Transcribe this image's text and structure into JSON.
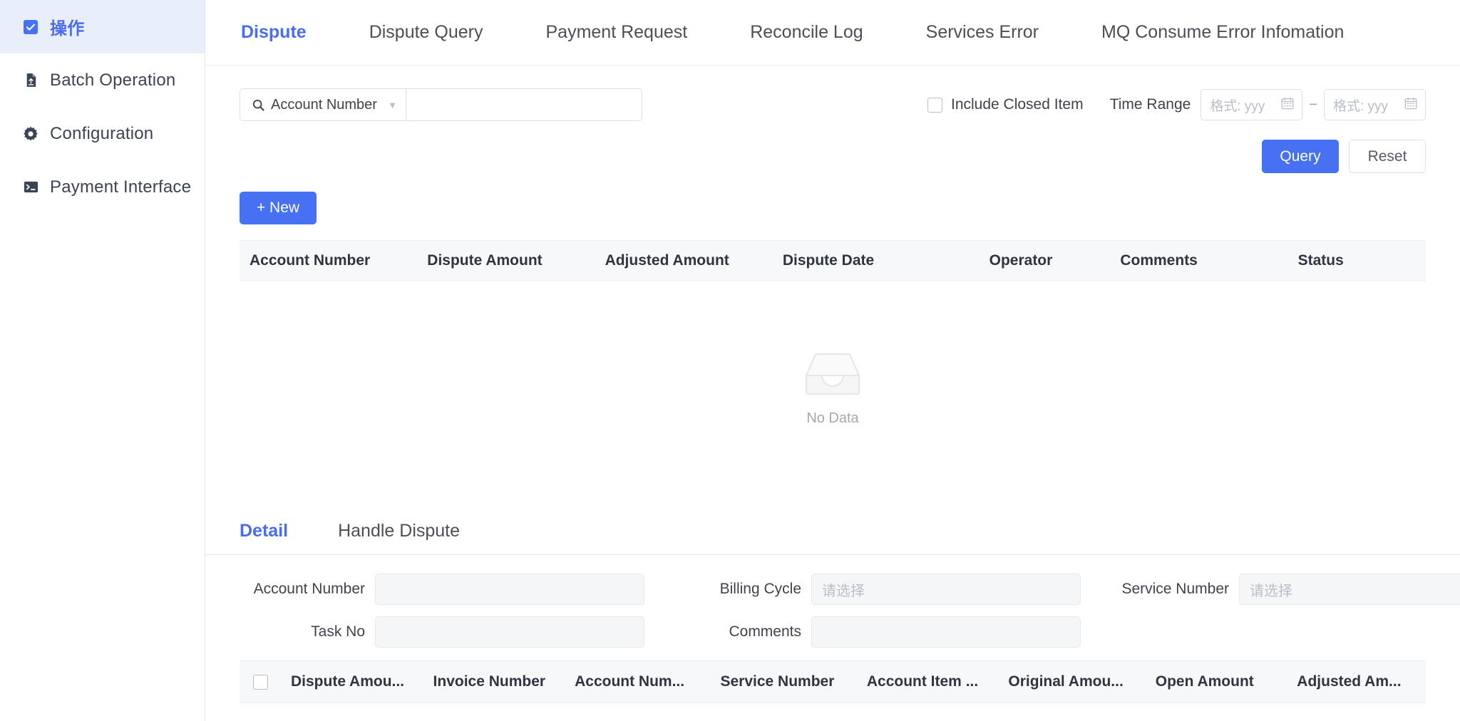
{
  "sidebar": {
    "items": [
      {
        "label": "操作",
        "icon": "checkbox-square-icon",
        "active": true
      },
      {
        "label": "Batch Operation",
        "icon": "file-upload-icon",
        "active": false
      },
      {
        "label": "Configuration",
        "icon": "gear-icon",
        "active": false
      },
      {
        "label": "Payment Interface",
        "icon": "terminal-icon",
        "active": false
      }
    ]
  },
  "tabs": [
    {
      "label": "Dispute",
      "active": true
    },
    {
      "label": "Dispute Query",
      "active": false
    },
    {
      "label": "Payment Request",
      "active": false
    },
    {
      "label": "Reconcile Log",
      "active": false
    },
    {
      "label": "Services Error",
      "active": false
    },
    {
      "label": "MQ Consume Error Infomation",
      "active": false
    }
  ],
  "filters": {
    "search_field_label": "Account Number",
    "search_value": "",
    "search_placeholder": "",
    "include_closed_label": "Include Closed Item",
    "include_closed_checked": false,
    "time_range_label": "Time Range",
    "date_start_placeholder": "格式: yyy",
    "date_end_placeholder": "格式: yyy",
    "date_separator": "−"
  },
  "buttons": {
    "query": "Query",
    "reset": "Reset",
    "new": "+ New"
  },
  "dispute_table": {
    "columns": [
      "Account Number",
      "Dispute Amount",
      "Adjusted Amount",
      "Dispute Date",
      "Operator",
      "Comments",
      "Status"
    ],
    "rows": [],
    "empty_text": "No Data"
  },
  "detail_tabs": [
    {
      "label": "Detail",
      "active": true
    },
    {
      "label": "Handle Dispute",
      "active": false
    }
  ],
  "detail_form": {
    "account_number_label": "Account Number",
    "account_number_value": "",
    "billing_cycle_label": "Billing Cycle",
    "billing_cycle_placeholder": "请选择",
    "service_number_label": "Service Number",
    "service_number_placeholder": "请选择",
    "task_no_label": "Task No",
    "task_no_value": "",
    "comments_label": "Comments",
    "comments_value": ""
  },
  "detail_table": {
    "columns": [
      "Dispute Amou...",
      "Invoice Number",
      "Account Num...",
      "Service Number",
      "Account Item ...",
      "Original Amou...",
      "Open Amount",
      "Adjusted Am..."
    ],
    "rows": []
  },
  "colors": {
    "accent": "#4671f2",
    "sidebar_active_bg": "#e9eefb",
    "table_header_bg": "#f7f8fa",
    "border": "#dcdfe6",
    "text": "#3f434c",
    "muted": "#b9bec9"
  }
}
